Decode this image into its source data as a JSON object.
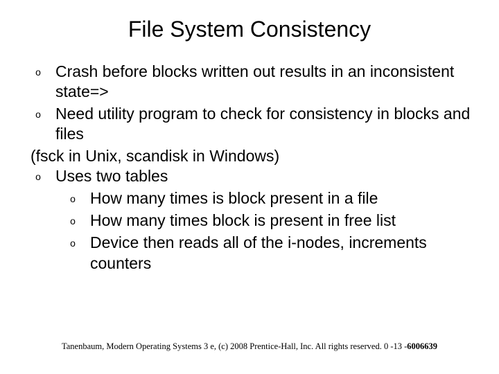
{
  "title": "File System Consistency",
  "items": {
    "l1a": "Crash before blocks written out results in an inconsistent state=>",
    "l1b": "Need utility program to check for consistency in blocks and files",
    "para": "(fsck in Unix, scandisk in Windows)",
    "l1c": "Uses two tables",
    "l2a": "How many times is block present in a file",
    "l2b": "How many times block is present in free list",
    "l2c": "Device then reads all of the i-nodes, increments counters"
  },
  "bullet": "o",
  "footer": "Tanenbaum, Modern Operating Systems 3 e, (c) 2008 Prentice-Hall, Inc. All rights reserved. 0 -13 -",
  "footer_bold": "6006639"
}
